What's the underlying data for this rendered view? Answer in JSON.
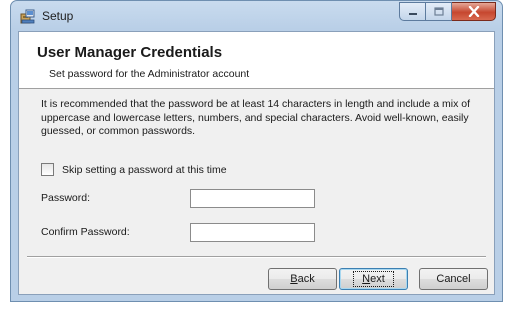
{
  "window": {
    "title": "Setup",
    "icon": "setup-app-icon"
  },
  "header": {
    "title": "User Manager Credentials",
    "subtitle": "Set password for the Administrator account"
  },
  "description": "It is recommended that the password be at least 14 characters in length and include a mix of uppercase and lowercase letters, numbers, and special characters. Avoid well-known, easily guessed, or common passwords.",
  "skip_checkbox": {
    "label": "Skip setting a password at this time",
    "checked": false
  },
  "fields": {
    "password": {
      "label": "Password:",
      "value": ""
    },
    "confirm": {
      "label": "Confirm Password:",
      "value": ""
    }
  },
  "buttons": {
    "back": {
      "accel": "B",
      "rest": "ack"
    },
    "next": {
      "accel": "N",
      "rest": "ext"
    },
    "cancel": "Cancel"
  }
}
